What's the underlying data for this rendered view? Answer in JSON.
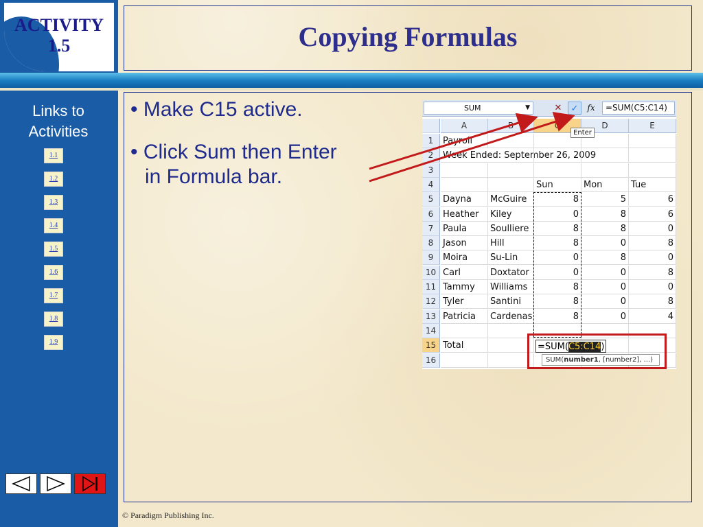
{
  "activity": {
    "label": "ACTIVITY",
    "number": "1.5"
  },
  "title": "Copying Formulas",
  "sidebar": {
    "heading_line1": "Links to",
    "heading_line2": "Activities",
    "links": [
      "1.1",
      "1.2",
      "1.3",
      "1.4",
      "1.5",
      "1.6",
      "1.7",
      "1.8",
      "1.9"
    ]
  },
  "bullets": [
    {
      "line1": "Make C15 active."
    },
    {
      "line1": "Click Sum then Enter",
      "line2": "in Formula bar."
    }
  ],
  "footer": "© Paradigm Publishing Inc.",
  "spreadsheet": {
    "name_box": "SUM",
    "cancel_icon": "✕",
    "enter_icon": "✓",
    "fx_icon": "fx",
    "formula": "=SUM(C5:C14)",
    "tooltip": "Enter",
    "columns": [
      "A",
      "B",
      "C",
      "D",
      "E"
    ],
    "rows": [
      {
        "n": "1",
        "cells": [
          "Payroll",
          "",
          "",
          "",
          ""
        ]
      },
      {
        "n": "2",
        "cells": [
          "Week Ended: September 26, 2009",
          "",
          "",
          "",
          ""
        ]
      },
      {
        "n": "3",
        "cells": [
          "",
          "",
          "",
          "",
          ""
        ]
      },
      {
        "n": "4",
        "cells": [
          "",
          "",
          "Sun",
          "Mon",
          "Tue"
        ]
      },
      {
        "n": "5",
        "cells": [
          "Dayna",
          "McGuire",
          "8",
          "5",
          "6"
        ]
      },
      {
        "n": "6",
        "cells": [
          "Heather",
          "Kiley",
          "0",
          "8",
          "6"
        ]
      },
      {
        "n": "7",
        "cells": [
          "Paula",
          "Soulliere",
          "8",
          "8",
          "0"
        ]
      },
      {
        "n": "8",
        "cells": [
          "Jason",
          "Hill",
          "8",
          "0",
          "8"
        ]
      },
      {
        "n": "9",
        "cells": [
          "Moira",
          "Su-Lin",
          "0",
          "8",
          "0"
        ]
      },
      {
        "n": "10",
        "cells": [
          "Carl",
          "Doxtator",
          "0",
          "0",
          "8"
        ]
      },
      {
        "n": "11",
        "cells": [
          "Tammy",
          "Williams",
          "8",
          "0",
          "0"
        ]
      },
      {
        "n": "12",
        "cells": [
          "Tyler",
          "Santini",
          "8",
          "0",
          "8"
        ]
      },
      {
        "n": "13",
        "cells": [
          "Patricia",
          "Cardenas",
          "8",
          "0",
          "4"
        ]
      },
      {
        "n": "14",
        "cells": [
          "",
          "",
          "",
          "",
          ""
        ]
      },
      {
        "n": "15",
        "cells": [
          "Total",
          "",
          "",
          "",
          ""
        ]
      },
      {
        "n": "16",
        "cells": [
          "",
          "",
          "",
          "",
          ""
        ]
      }
    ],
    "edit_prefix": "=SUM(",
    "edit_range": "C5:C14",
    "edit_suffix": ")",
    "syntax_fn": "SUM(",
    "syntax_arg": "number1",
    "syntax_rest": ", [number2], ...)"
  },
  "colors": {
    "accent_red": "#c21a1a",
    "title_blue": "#2e2e8c",
    "sidebar_blue": "#1a5ca6"
  }
}
